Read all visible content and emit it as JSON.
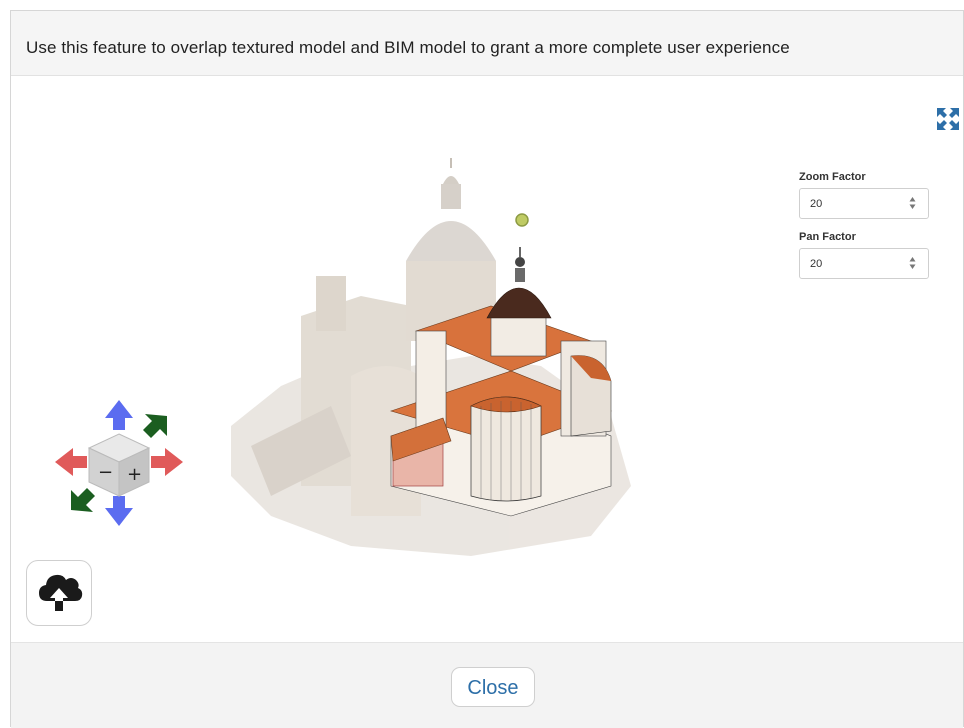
{
  "header": {
    "title": "Use this feature to overlap textured model and BIM model to grant a more complete user experience"
  },
  "controls": {
    "zoom": {
      "label": "Zoom Factor",
      "value": "20"
    },
    "pan": {
      "label": "Pan Factor",
      "value": "20"
    }
  },
  "icons": {
    "expand": "expand-arrows-icon",
    "upload": "cloud-upload-icon",
    "navigation": "navigation-cube-icon"
  },
  "colors": {
    "accent": "#2d6fa8",
    "red_arrow": "#e05a5a",
    "blue_arrow": "#5b6cf0",
    "green_arrow": "#1b5e20",
    "roof": "#d9743d"
  },
  "footer": {
    "close_label": "Close"
  }
}
